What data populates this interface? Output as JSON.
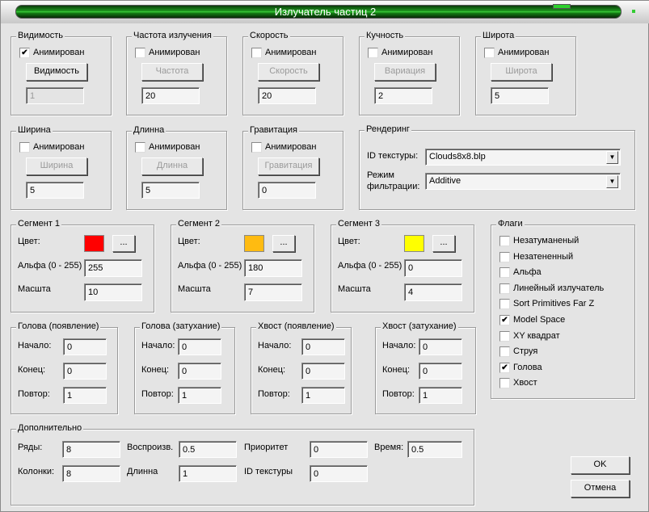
{
  "title": "Излучатель частиц 2",
  "param_groups": [
    {
      "label": "Видимость",
      "animated_label": "Анимирован",
      "animated": true,
      "button": "Видимость",
      "button_enabled": true,
      "value": "1",
      "value_enabled": false
    },
    {
      "label": "Частота излучения",
      "animated_label": "Анимирован",
      "animated": false,
      "button": "Частота",
      "button_enabled": false,
      "value": "20",
      "value_enabled": true
    },
    {
      "label": "Скорость",
      "animated_label": "Анимирован",
      "animated": false,
      "button": "Скорость",
      "button_enabled": false,
      "value": "20",
      "value_enabled": true
    },
    {
      "label": "Кучность",
      "animated_label": "Анимирован",
      "animated": false,
      "button": "Вариация",
      "button_enabled": false,
      "value": "2",
      "value_enabled": true
    },
    {
      "label": "Широта",
      "animated_label": "Анимирован",
      "animated": false,
      "button": "Широта",
      "button_enabled": false,
      "value": "5",
      "value_enabled": true
    },
    {
      "label": "Ширина",
      "animated_label": "Анимирован",
      "animated": false,
      "button": "Ширина",
      "button_enabled": false,
      "value": "5",
      "value_enabled": true
    },
    {
      "label": "Длинна",
      "animated_label": "Анимирован",
      "animated": false,
      "button": "Длинна",
      "button_enabled": false,
      "value": "5",
      "value_enabled": true
    },
    {
      "label": "Гравитация",
      "animated_label": "Анимирован",
      "animated": false,
      "button": "Гравитация",
      "button_enabled": false,
      "value": "0",
      "value_enabled": true
    }
  ],
  "rendering": {
    "label": "Рендеринг",
    "texture_label": "ID текстуры:",
    "texture_value": "Clouds8x8.blp",
    "filter_label_1": "Режим",
    "filter_label_2": "фильтрации:",
    "filter_value": "Additive"
  },
  "segments": [
    {
      "label": "Сегмент 1",
      "color_label": "Цвет:",
      "color": "#ff0000",
      "browse": "...",
      "alpha_label": "Альфа (0 - 255)",
      "alpha": "255",
      "scale_label": "Масшта",
      "scale": "10"
    },
    {
      "label": "Сегмент 2",
      "color_label": "Цвет:",
      "color": "#ffbb11",
      "browse": "...",
      "alpha_label": "Альфа (0 - 255)",
      "alpha": "180",
      "scale_label": "Масшта",
      "scale": "7"
    },
    {
      "label": "Сегмент 3",
      "color_label": "Цвет:",
      "color": "#ffff00",
      "browse": "...",
      "alpha_label": "Альфа (0 - 255)",
      "alpha": "0",
      "scale_label": "Масшта",
      "scale": "4"
    }
  ],
  "flags": {
    "label": "Флаги",
    "items": [
      {
        "label": "Незатуманеный",
        "checked": false
      },
      {
        "label": "Незатененный",
        "checked": false
      },
      {
        "label": "Альфа",
        "checked": false
      },
      {
        "label": "Линейный излучатель",
        "checked": false
      },
      {
        "label": "Sort Primitives Far Z",
        "checked": false
      },
      {
        "label": "Model Space",
        "checked": true
      },
      {
        "label": "XY квадрат",
        "checked": false
      },
      {
        "label": "Струя",
        "checked": false
      },
      {
        "label": "Голова",
        "checked": true
      },
      {
        "label": "Хвост",
        "checked": false
      }
    ]
  },
  "timing_groups": [
    {
      "label": "Голова (появление)",
      "start_label": "Начало:",
      "start": "0",
      "end_label": "Конец:",
      "end": "0",
      "repeat_label": "Повтор:",
      "repeat": "1"
    },
    {
      "label": "Голова (затухание)",
      "start_label": "Начало:",
      "start": "0",
      "end_label": "Конец:",
      "end": "0",
      "repeat_label": "Повтор:",
      "repeat": "1"
    },
    {
      "label": "Хвост (появление)",
      "start_label": "Начало:",
      "start": "0",
      "end_label": "Конец:",
      "end": "0",
      "repeat_label": "Повтор:",
      "repeat": "1"
    },
    {
      "label": "Хвост (затухание)",
      "start_label": "Начало:",
      "start": "0",
      "end_label": "Конец:",
      "end": "0",
      "repeat_label": "Повтор:",
      "repeat": "1"
    }
  ],
  "extra": {
    "label": "Дополнительно",
    "fields": [
      {
        "label": "Ряды:",
        "value": "8"
      },
      {
        "label": "Колонки:",
        "value": "8"
      },
      {
        "label": "Воспроизв.",
        "value": "0.5"
      },
      {
        "label": "Длинна",
        "value": "1"
      },
      {
        "label": "Приоритет",
        "value": "0"
      },
      {
        "label": "ID текстуры",
        "value": "0"
      },
      {
        "label": "Время:",
        "value": "0.5"
      }
    ]
  },
  "ok": "OK",
  "cancel": "Отмена"
}
